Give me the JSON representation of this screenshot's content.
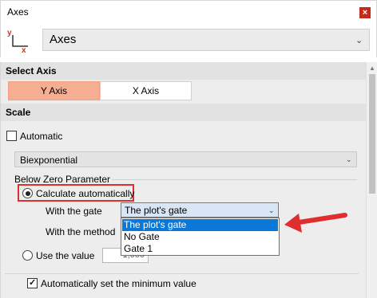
{
  "window": {
    "title": "Axes",
    "close_glyph": "×"
  },
  "header": {
    "icon": {
      "name": "axes-icon",
      "y_letter": "y",
      "x_letter": "x"
    },
    "select_value": "Axes"
  },
  "select_axis": {
    "heading": "Select Axis",
    "buttons": [
      {
        "label": "Y Axis",
        "selected": true
      },
      {
        "label": "X Axis",
        "selected": false
      }
    ]
  },
  "scale": {
    "heading": "Scale",
    "automatic_label": "Automatic",
    "automatic_checked": false,
    "transform_value": "Biexponential",
    "below_zero_group": "Below Zero Parameter",
    "calc_auto_label": "Calculate automatically",
    "calc_auto_selected": true,
    "with_gate_label": "With the gate",
    "gate_value": "The plot's gate",
    "gate_options": [
      "The plot's gate",
      "No Gate",
      "Gate 1"
    ],
    "gate_selected_index": 0,
    "with_method_label": "With the method",
    "use_value_label": "Use the value",
    "use_value_selected": false,
    "value_partial": "1,000",
    "auto_min_label": "Automatically set the minimum value",
    "auto_min_checked": true
  },
  "colors": {
    "accent_selected": "#f6ae92",
    "annotation_red": "#e02d2d",
    "list_highlight": "#0a78d7"
  }
}
